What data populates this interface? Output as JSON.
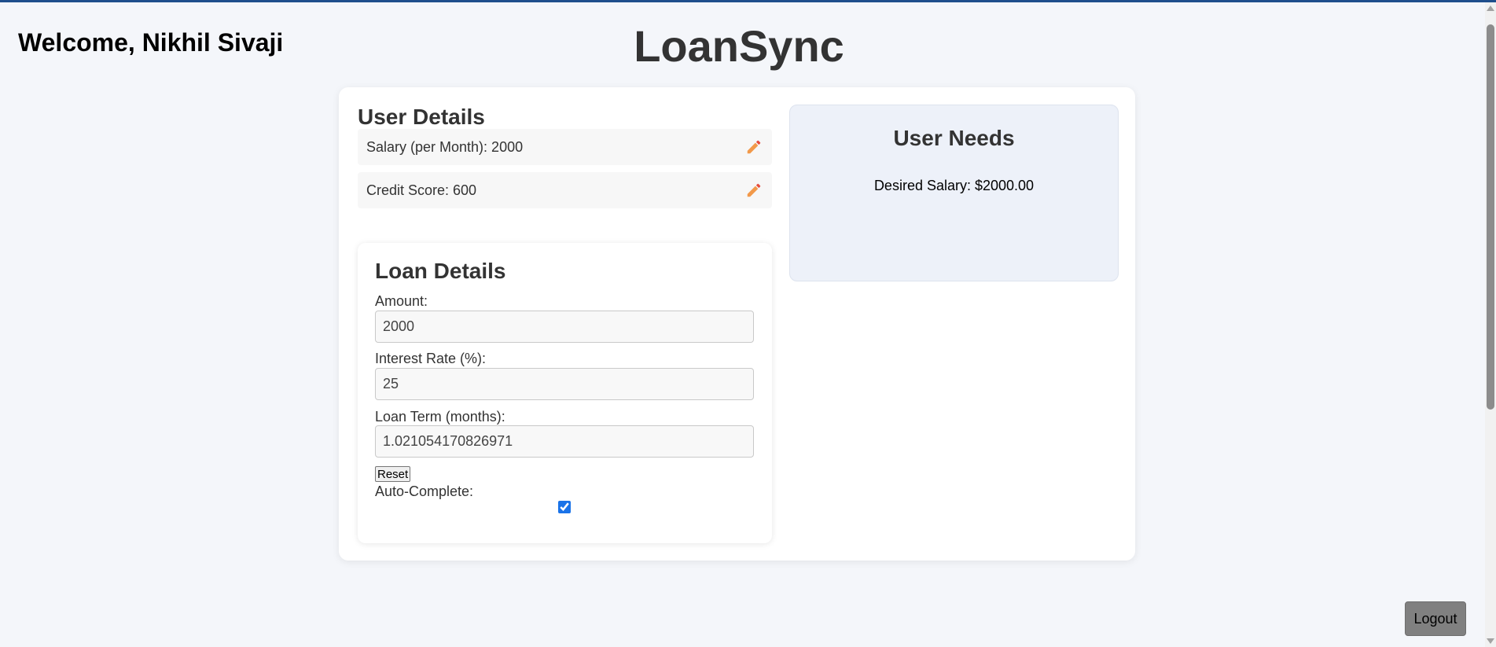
{
  "header": {
    "welcome": "Welcome, Nikhil Sivaji",
    "app_title": "LoanSync"
  },
  "user_details": {
    "title": "User Details",
    "salary": "Salary (per Month): 2000",
    "credit_score": "Credit Score: 600",
    "edit_icon": "pencil-icon"
  },
  "loan_details": {
    "title": "Loan Details",
    "amount_label": "Amount:",
    "amount_value": "2000",
    "interest_label": "Interest Rate (%):",
    "interest_value": "25",
    "term_label": "Loan Term (months):",
    "term_value": "1.021054170826971",
    "reset_label": "Reset",
    "auto_complete_label": "Auto-Complete:",
    "auto_complete_checked": true
  },
  "user_needs": {
    "title": "User Needs",
    "desired_salary": "Desired Salary: $2000.00"
  },
  "logout_label": "Logout",
  "colors": {
    "page_background": "#f4f6fa",
    "card_background": "#ffffff",
    "needs_background": "#edf1f9",
    "pencil_orange": "#f2994a",
    "pencil_tip": "#e74c3c",
    "logout_button": "#808080",
    "top_bar": "#1f4e8c"
  }
}
